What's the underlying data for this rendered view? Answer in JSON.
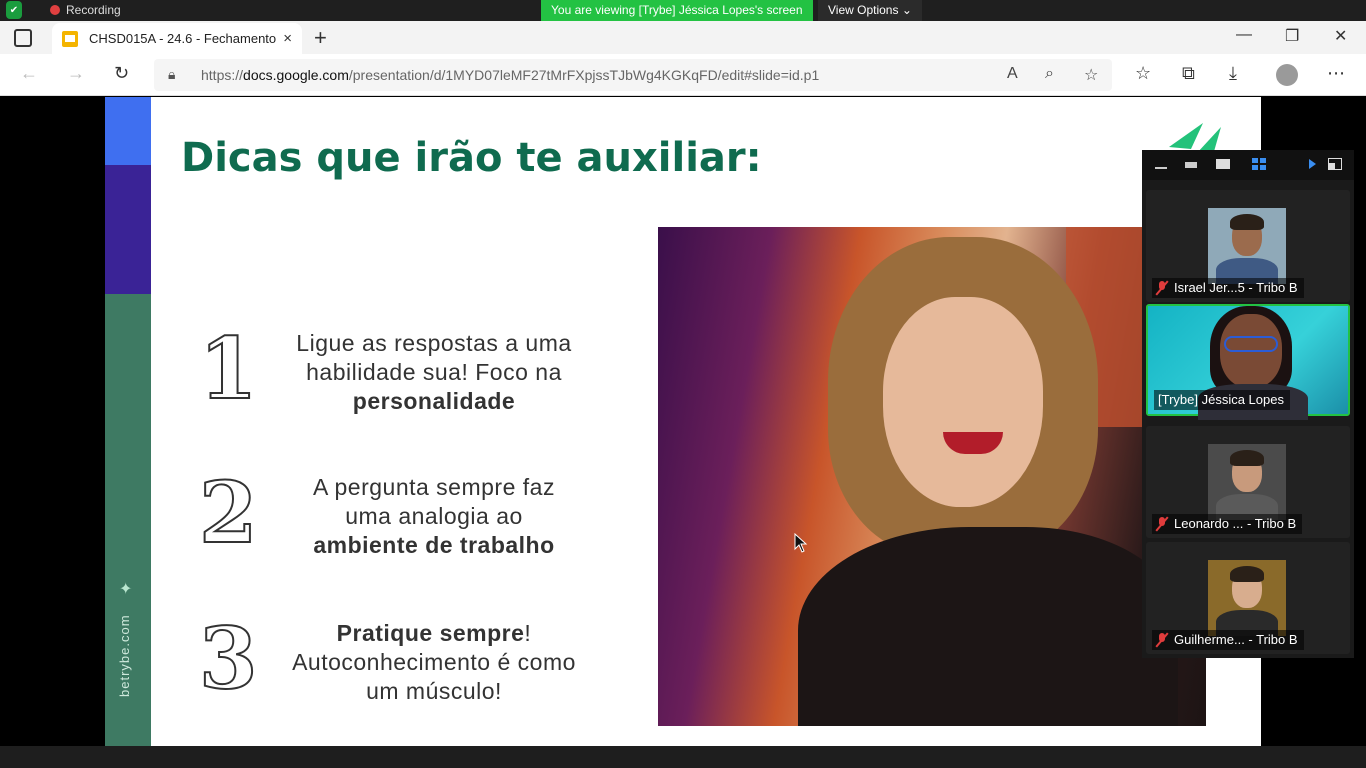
{
  "zoom": {
    "recording_label": "Recording",
    "viewing_banner": "You are viewing [Trybe] Jéssica Lopes's screen",
    "view_options": "View Options ⌄",
    "participants": [
      {
        "name": "Israel Jer...5 - Tribo B",
        "muted": true
      },
      {
        "name": "[Trybe] Jéssica Lopes",
        "muted": false,
        "active_speaker": true
      },
      {
        "name": "Leonardo ... - Tribo B",
        "muted": true
      },
      {
        "name": "Guilherme... - Tribo B",
        "muted": true
      }
    ]
  },
  "browser": {
    "tab_title": "CHSD015A - 24.6 - Fechamento | ",
    "tab_close": "×",
    "new_tab": "+",
    "url_prefix": "https://",
    "url_host": "docs.google.com",
    "url_path": "/presentation/d/1MYD07leMF27tMrFXpjssTJbWg4KGKqFD/edit#slide=id.p1",
    "window_minimize": "—",
    "window_restore": "❐",
    "window_close": "✕"
  },
  "slide": {
    "title": "Dicas que irão te auxiliar:",
    "side_text": "betrybe.com",
    "tips": [
      {
        "number": "1",
        "line1": "Ligue as respostas a uma",
        "line2": "habilidade sua! Foco na",
        "bold": "personalidade"
      },
      {
        "number": "2",
        "line1": "A pergunta sempre faz",
        "line2": "uma analogia ao",
        "bold": "ambiente de trabalho"
      },
      {
        "number": "3",
        "bold": "Pratique sempre",
        "line1_suffix": "!",
        "line2": "Autoconhecimento é como",
        "line3": "um músculo!"
      }
    ]
  },
  "colors": {
    "title_green": "#0f6b4f",
    "zoom_green": "#23c243",
    "band_blue": "#3f6ff0",
    "band_purple": "#3a2396",
    "band_green": "#3e7a63"
  }
}
